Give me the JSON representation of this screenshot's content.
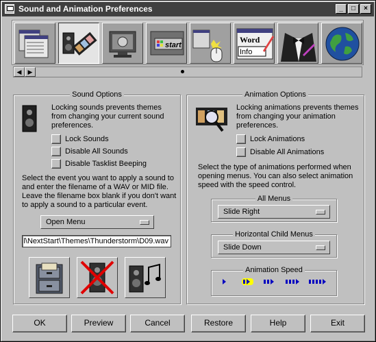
{
  "window": {
    "title": "Sound and Animation Preferences",
    "controls": {
      "minimize": "_",
      "maximize": "□",
      "close": "×"
    }
  },
  "toolbar": {
    "icons": [
      "menu-windows-icon",
      "speaker-film-icon",
      "monitor-speaker-icon",
      "start-button-icon",
      "mouse-cursor-icon",
      "word-info-icon",
      "tuxedo-icon",
      "globe-icon"
    ],
    "active_index": 1,
    "thumbnail_labels": {
      "start": "start",
      "word": "Word",
      "info": "Info"
    }
  },
  "sound_options": {
    "legend": "Sound Options",
    "description": "Locking sounds prevents themes from changing your current sound preferences.",
    "checkboxes": [
      "Lock Sounds",
      "Disable All Sounds",
      "Disable Tasklist Beeping"
    ],
    "instructions": "Select the event you want to apply a sound to and enter the filename of a WAV or MID file. Leave the filename box blank if you don't want to apply a sound to a particular event.",
    "event_select": "Open Menu",
    "filename": "l\\NextStart\\Themes\\Thunderstorm\\D09.wav"
  },
  "animation_options": {
    "legend": "Animation Options",
    "description": "Locking animations prevents themes from changing your animation preferences.",
    "checkboxes": [
      "Lock Animations",
      "Disable All Animations"
    ],
    "instructions": "Select the type of animations performed when opening menus. You can also select animation speed with the speed control.",
    "all_menus": {
      "legend": "All Menus",
      "value": "Slide Right"
    },
    "child_menus": {
      "legend": "Horizontal Child Menus",
      "value": "Slide Down"
    },
    "speed": {
      "legend": "Animation Speed",
      "levels": 5,
      "selected": 2
    }
  },
  "buttons": [
    "OK",
    "Preview",
    "Cancel",
    "Restore",
    "Help",
    "Exit"
  ],
  "colors": {
    "face": "#c0c0c0",
    "titlebar": "#404040",
    "speed_active": "#ffff00",
    "speed_arrow": "#0000c0"
  }
}
